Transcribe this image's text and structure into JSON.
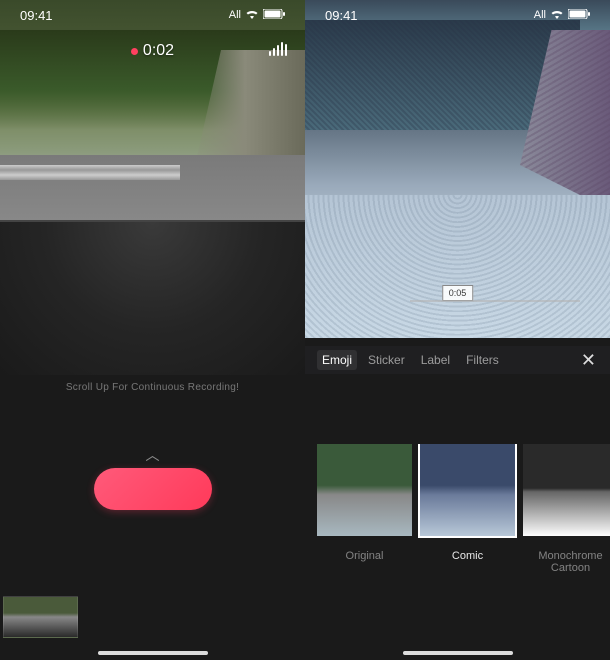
{
  "status": {
    "time": "09:41",
    "carrier": "All"
  },
  "left": {
    "timer": "0:02",
    "scroll_hint": "Scroll Up For Continuous Recording!",
    "chevron": "︿"
  },
  "right": {
    "playback_time": "0:05",
    "tabs": {
      "emoji": "Emoji",
      "sticker": "Sticker",
      "label": "Label",
      "filters": "Filters"
    },
    "close": "✕",
    "filters": [
      {
        "name": "Original"
      },
      {
        "name": "Comic"
      },
      {
        "name": "Monochrome Cartoon"
      }
    ]
  }
}
